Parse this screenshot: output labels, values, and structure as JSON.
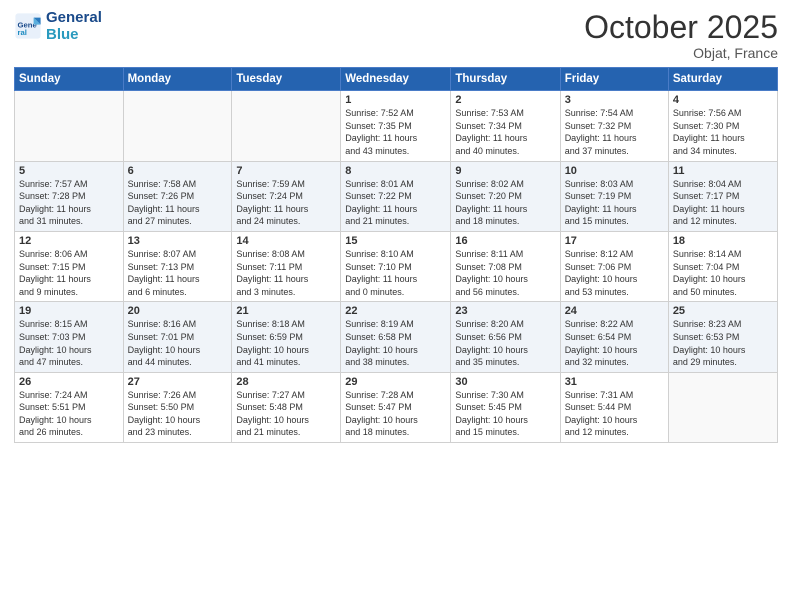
{
  "header": {
    "logo_line1": "General",
    "logo_line2": "Blue",
    "month_title": "October 2025",
    "location": "Objat, France"
  },
  "days_of_week": [
    "Sunday",
    "Monday",
    "Tuesday",
    "Wednesday",
    "Thursday",
    "Friday",
    "Saturday"
  ],
  "weeks": [
    [
      {
        "day": "",
        "info": ""
      },
      {
        "day": "",
        "info": ""
      },
      {
        "day": "",
        "info": ""
      },
      {
        "day": "1",
        "info": "Sunrise: 7:52 AM\nSunset: 7:35 PM\nDaylight: 11 hours\nand 43 minutes."
      },
      {
        "day": "2",
        "info": "Sunrise: 7:53 AM\nSunset: 7:34 PM\nDaylight: 11 hours\nand 40 minutes."
      },
      {
        "day": "3",
        "info": "Sunrise: 7:54 AM\nSunset: 7:32 PM\nDaylight: 11 hours\nand 37 minutes."
      },
      {
        "day": "4",
        "info": "Sunrise: 7:56 AM\nSunset: 7:30 PM\nDaylight: 11 hours\nand 34 minutes."
      }
    ],
    [
      {
        "day": "5",
        "info": "Sunrise: 7:57 AM\nSunset: 7:28 PM\nDaylight: 11 hours\nand 31 minutes."
      },
      {
        "day": "6",
        "info": "Sunrise: 7:58 AM\nSunset: 7:26 PM\nDaylight: 11 hours\nand 27 minutes."
      },
      {
        "day": "7",
        "info": "Sunrise: 7:59 AM\nSunset: 7:24 PM\nDaylight: 11 hours\nand 24 minutes."
      },
      {
        "day": "8",
        "info": "Sunrise: 8:01 AM\nSunset: 7:22 PM\nDaylight: 11 hours\nand 21 minutes."
      },
      {
        "day": "9",
        "info": "Sunrise: 8:02 AM\nSunset: 7:20 PM\nDaylight: 11 hours\nand 18 minutes."
      },
      {
        "day": "10",
        "info": "Sunrise: 8:03 AM\nSunset: 7:19 PM\nDaylight: 11 hours\nand 15 minutes."
      },
      {
        "day": "11",
        "info": "Sunrise: 8:04 AM\nSunset: 7:17 PM\nDaylight: 11 hours\nand 12 minutes."
      }
    ],
    [
      {
        "day": "12",
        "info": "Sunrise: 8:06 AM\nSunset: 7:15 PM\nDaylight: 11 hours\nand 9 minutes."
      },
      {
        "day": "13",
        "info": "Sunrise: 8:07 AM\nSunset: 7:13 PM\nDaylight: 11 hours\nand 6 minutes."
      },
      {
        "day": "14",
        "info": "Sunrise: 8:08 AM\nSunset: 7:11 PM\nDaylight: 11 hours\nand 3 minutes."
      },
      {
        "day": "15",
        "info": "Sunrise: 8:10 AM\nSunset: 7:10 PM\nDaylight: 11 hours\nand 0 minutes."
      },
      {
        "day": "16",
        "info": "Sunrise: 8:11 AM\nSunset: 7:08 PM\nDaylight: 10 hours\nand 56 minutes."
      },
      {
        "day": "17",
        "info": "Sunrise: 8:12 AM\nSunset: 7:06 PM\nDaylight: 10 hours\nand 53 minutes."
      },
      {
        "day": "18",
        "info": "Sunrise: 8:14 AM\nSunset: 7:04 PM\nDaylight: 10 hours\nand 50 minutes."
      }
    ],
    [
      {
        "day": "19",
        "info": "Sunrise: 8:15 AM\nSunset: 7:03 PM\nDaylight: 10 hours\nand 47 minutes."
      },
      {
        "day": "20",
        "info": "Sunrise: 8:16 AM\nSunset: 7:01 PM\nDaylight: 10 hours\nand 44 minutes."
      },
      {
        "day": "21",
        "info": "Sunrise: 8:18 AM\nSunset: 6:59 PM\nDaylight: 10 hours\nand 41 minutes."
      },
      {
        "day": "22",
        "info": "Sunrise: 8:19 AM\nSunset: 6:58 PM\nDaylight: 10 hours\nand 38 minutes."
      },
      {
        "day": "23",
        "info": "Sunrise: 8:20 AM\nSunset: 6:56 PM\nDaylight: 10 hours\nand 35 minutes."
      },
      {
        "day": "24",
        "info": "Sunrise: 8:22 AM\nSunset: 6:54 PM\nDaylight: 10 hours\nand 32 minutes."
      },
      {
        "day": "25",
        "info": "Sunrise: 8:23 AM\nSunset: 6:53 PM\nDaylight: 10 hours\nand 29 minutes."
      }
    ],
    [
      {
        "day": "26",
        "info": "Sunrise: 7:24 AM\nSunset: 5:51 PM\nDaylight: 10 hours\nand 26 minutes."
      },
      {
        "day": "27",
        "info": "Sunrise: 7:26 AM\nSunset: 5:50 PM\nDaylight: 10 hours\nand 23 minutes."
      },
      {
        "day": "28",
        "info": "Sunrise: 7:27 AM\nSunset: 5:48 PM\nDaylight: 10 hours\nand 21 minutes."
      },
      {
        "day": "29",
        "info": "Sunrise: 7:28 AM\nSunset: 5:47 PM\nDaylight: 10 hours\nand 18 minutes."
      },
      {
        "day": "30",
        "info": "Sunrise: 7:30 AM\nSunset: 5:45 PM\nDaylight: 10 hours\nand 15 minutes."
      },
      {
        "day": "31",
        "info": "Sunrise: 7:31 AM\nSunset: 5:44 PM\nDaylight: 10 hours\nand 12 minutes."
      },
      {
        "day": "",
        "info": ""
      }
    ]
  ]
}
